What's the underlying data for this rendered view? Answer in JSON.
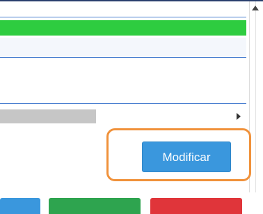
{
  "form": {
    "modify_label": "Modificar"
  },
  "colors": {
    "accent": "#3a97dd",
    "success": "#2ecc40",
    "highlight": "#f0913a",
    "danger": "#e0353a",
    "confirm": "#2ea44f"
  },
  "icons": {
    "scroll_up": "triangle-up",
    "scroll_right": "triangle-right"
  }
}
